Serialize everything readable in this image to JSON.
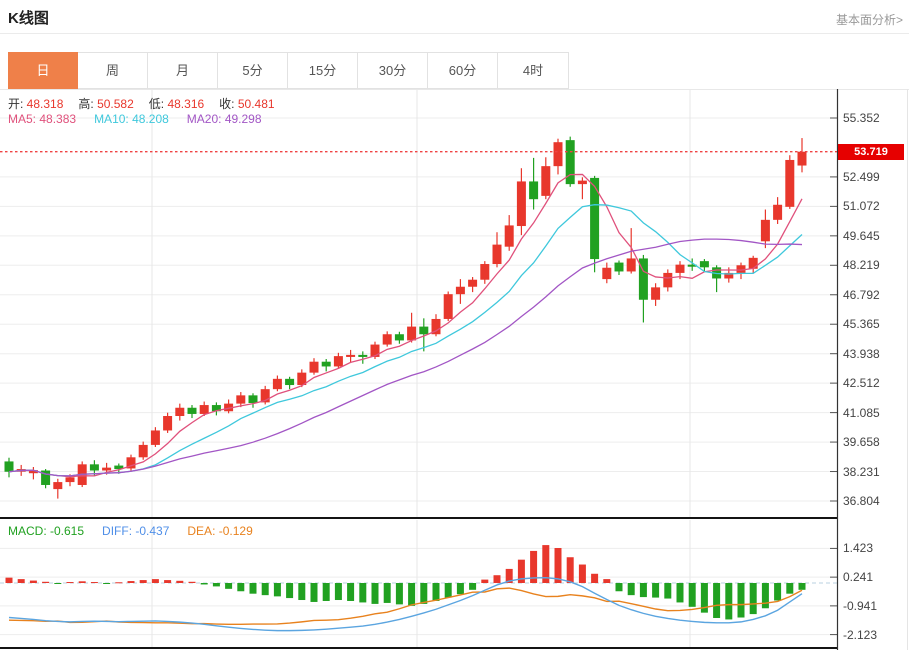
{
  "header": {
    "title": "K线图",
    "fundamental_link": "基本面分析>"
  },
  "tabs": {
    "items": [
      "日",
      "周",
      "月",
      "5分",
      "15分",
      "30分",
      "60分",
      "4时"
    ],
    "active_index": 0
  },
  "ohlc_legend": {
    "items": [
      {
        "label": "开:",
        "value": "48.318"
      },
      {
        "label": "高:",
        "value": "50.582"
      },
      {
        "label": "低:",
        "value": "48.316"
      },
      {
        "label": "收:",
        "value": "50.481"
      }
    ],
    "value_color": "#e8372c"
  },
  "ma_legend": {
    "items": [
      {
        "label": "MA5:",
        "value": "48.383",
        "color": "#e0517c"
      },
      {
        "label": "MA10:",
        "value": "48.208",
        "color": "#3fc8dc"
      },
      {
        "label": "MA20:",
        "value": "49.298",
        "color": "#a256c5"
      }
    ]
  },
  "macd_legend": {
    "items": [
      {
        "label": "MACD:",
        "value": "-0.615",
        "color": "#21a121"
      },
      {
        "label": "DIFF:",
        "value": "-0.437",
        "color": "#4f8fe8"
      },
      {
        "label": "DEA:",
        "value": "-0.129",
        "color": "#e8821e"
      }
    ]
  },
  "colors": {
    "up": "#e8372c",
    "down": "#21a121",
    "ma5": "#e0517c",
    "ma10": "#3fc8dc",
    "ma20": "#a256c5",
    "diff": "#5ba5e0",
    "dea": "#e8821e",
    "badge_bg": "#e60000",
    "price_line": "#ef4444",
    "grid": "#ededed",
    "vgrid": "#e7e7e7",
    "axis": "#444",
    "dark_separator": "#141414",
    "zero_dash": "#b9d2e0",
    "tab_active_bg": "#ef8049"
  },
  "chart_data": {
    "type": "candlestick+macd",
    "legend_position": "top-left",
    "grid": true,
    "current_price": "53.719",
    "price_axis_ticks": [
      "55.352",
      "52.499",
      "51.072",
      "49.645",
      "48.219",
      "46.792",
      "45.365",
      "43.938",
      "42.512",
      "41.085",
      "39.658",
      "38.231",
      "36.804"
    ],
    "price_axis_range": [
      36.1,
      55.96
    ],
    "macd_axis_ticks": [
      "1.423",
      "0.241",
      "-0.941",
      "-2.123"
    ],
    "candles_ohlc": [
      [
        38.72,
        38.9,
        37.95,
        38.22
      ],
      [
        38.22,
        38.55,
        38.02,
        38.35
      ],
      [
        38.15,
        38.45,
        37.85,
        38.3
      ],
      [
        38.28,
        38.35,
        37.42,
        37.58
      ],
      [
        37.38,
        37.88,
        36.92,
        37.72
      ],
      [
        37.72,
        38.1,
        37.52,
        37.95
      ],
      [
        37.58,
        38.72,
        37.48,
        38.58
      ],
      [
        38.58,
        38.78,
        38.02,
        38.28
      ],
      [
        38.28,
        38.65,
        38.08,
        38.42
      ],
      [
        38.52,
        38.62,
        38.12,
        38.35
      ],
      [
        38.38,
        39.05,
        38.25,
        38.92
      ],
      [
        38.92,
        39.68,
        38.8,
        39.52
      ],
      [
        39.52,
        40.38,
        39.42,
        40.22
      ],
      [
        40.22,
        41.08,
        40.1,
        40.92
      ],
      [
        40.92,
        41.52,
        40.7,
        41.32
      ],
      [
        41.32,
        41.45,
        40.82,
        41.02
      ],
      [
        41.02,
        41.62,
        40.92,
        41.45
      ],
      [
        41.45,
        41.58,
        40.95,
        41.15
      ],
      [
        41.15,
        41.72,
        41.05,
        41.52
      ],
      [
        41.52,
        42.08,
        41.35,
        41.92
      ],
      [
        41.92,
        42.02,
        41.32,
        41.55
      ],
      [
        41.58,
        42.38,
        41.48,
        42.22
      ],
      [
        42.22,
        42.88,
        42.12,
        42.72
      ],
      [
        42.72,
        42.82,
        42.22,
        42.42
      ],
      [
        42.42,
        43.18,
        42.32,
        43.02
      ],
      [
        43.02,
        43.72,
        42.92,
        43.55
      ],
      [
        43.55,
        43.68,
        43.08,
        43.32
      ],
      [
        43.32,
        43.98,
        43.22,
        43.82
      ],
      [
        43.78,
        44.12,
        43.52,
        43.88
      ],
      [
        43.88,
        44.05,
        43.45,
        43.78
      ],
      [
        43.78,
        44.52,
        43.68,
        44.38
      ],
      [
        44.38,
        45.02,
        44.28,
        44.88
      ],
      [
        44.88,
        45.0,
        44.42,
        44.58
      ],
      [
        44.58,
        45.92,
        44.48,
        45.25
      ],
      [
        45.25,
        45.65,
        44.05,
        44.88
      ],
      [
        44.88,
        45.85,
        44.78,
        45.62
      ],
      [
        45.62,
        46.95,
        45.52,
        46.82
      ],
      [
        46.82,
        47.55,
        46.35,
        47.18
      ],
      [
        47.18,
        47.65,
        46.92,
        47.52
      ],
      [
        47.52,
        48.42,
        47.32,
        48.28
      ],
      [
        48.28,
        49.82,
        48.12,
        49.22
      ],
      [
        49.12,
        50.65,
        48.92,
        50.15
      ],
      [
        50.12,
        52.92,
        49.68,
        52.28
      ],
      [
        52.28,
        53.42,
        50.92,
        51.42
      ],
      [
        51.58,
        53.45,
        51.42,
        53.02
      ],
      [
        53.02,
        54.35,
        52.62,
        54.18
      ],
      [
        54.28,
        54.45,
        52.02,
        52.15
      ],
      [
        52.15,
        52.48,
        51.42,
        52.32
      ],
      [
        52.45,
        52.55,
        47.88,
        48.52
      ],
      [
        47.55,
        48.35,
        47.35,
        48.1
      ],
      [
        48.35,
        48.45,
        47.75,
        47.92
      ],
      [
        47.92,
        50.02,
        47.82,
        48.55
      ],
      [
        48.55,
        48.72,
        45.45,
        46.55
      ],
      [
        46.55,
        47.35,
        46.25,
        47.15
      ],
      [
        47.15,
        48.02,
        46.95,
        47.85
      ],
      [
        47.85,
        48.42,
        47.55,
        48.25
      ],
      [
        48.25,
        48.55,
        47.95,
        48.15
      ],
      [
        48.42,
        48.52,
        47.92,
        48.12
      ],
      [
        48.12,
        48.22,
        46.92,
        47.58
      ],
      [
        47.58,
        48.12,
        47.38,
        47.85
      ],
      [
        47.85,
        48.35,
        47.55,
        48.22
      ],
      [
        48.05,
        48.68,
        47.82,
        48.58
      ],
      [
        49.38,
        50.92,
        49.05,
        50.42
      ],
      [
        50.42,
        51.52,
        50.22,
        51.15
      ],
      [
        51.05,
        53.55,
        50.95,
        53.32
      ],
      [
        53.05,
        54.38,
        52.72,
        53.72
      ]
    ],
    "ma_windows": [
      5,
      10,
      20
    ],
    "macd": {
      "diff": [
        -1.42,
        -1.46,
        -1.5,
        -1.55,
        -1.58,
        -1.6,
        -1.58,
        -1.57,
        -1.58,
        -1.59,
        -1.58,
        -1.57,
        -1.56,
        -1.58,
        -1.61,
        -1.65,
        -1.7,
        -1.76,
        -1.82,
        -1.87,
        -1.91,
        -1.94,
        -1.96,
        -1.96,
        -1.95,
        -1.93,
        -1.9,
        -1.86,
        -1.82,
        -1.77,
        -1.7,
        -1.61,
        -1.5,
        -1.37,
        -1.23,
        -1.08,
        -0.9,
        -0.72,
        -0.52,
        -0.3,
        -0.08,
        0.08,
        0.17,
        0.21,
        0.22,
        0.17,
        0.05,
        -0.15,
        -0.42,
        -0.68,
        -0.92,
        -1.1,
        -1.25,
        -1.37,
        -1.46,
        -1.53,
        -1.58,
        -1.62,
        -1.64,
        -1.64,
        -1.6,
        -1.5,
        -1.35,
        -1.12,
        -0.78,
        -0.44
      ],
      "hist": [
        0.22,
        0.16,
        0.1,
        0.05,
        -0.03,
        0.04,
        0.07,
        0.04,
        -0.03,
        0.03,
        0.08,
        0.12,
        0.16,
        0.12,
        0.09,
        0.05,
        -0.06,
        -0.14,
        -0.24,
        -0.34,
        -0.44,
        -0.5,
        -0.55,
        -0.62,
        -0.7,
        -0.78,
        -0.74,
        -0.7,
        -0.74,
        -0.8,
        -0.86,
        -0.82,
        -0.88,
        -0.94,
        -0.86,
        -0.74,
        -0.6,
        -0.46,
        -0.28,
        0.14,
        0.32,
        0.58,
        0.96,
        1.32,
        1.56,
        1.44,
        1.06,
        0.76,
        0.38,
        0.16,
        -0.34,
        -0.5,
        -0.58,
        -0.6,
        -0.64,
        -0.8,
        -0.98,
        -1.22,
        -1.44,
        -1.5,
        -1.42,
        -1.28,
        -1.04,
        -0.72,
        -0.44,
        -0.28
      ]
    }
  }
}
